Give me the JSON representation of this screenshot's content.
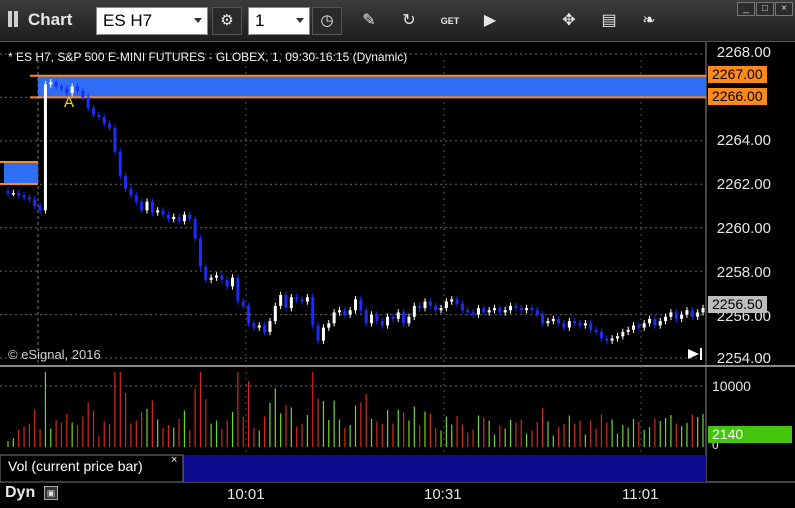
{
  "window": {
    "title": "Chart"
  },
  "toolbar": {
    "symbol": "ES H7",
    "interval": "1",
    "buttons": [
      {
        "name": "settings-icon",
        "glyph": "⚙"
      },
      {
        "name": "clock-icon",
        "glyph": "◷"
      },
      {
        "name": "pencil-icon",
        "glyph": "✎"
      },
      {
        "name": "refresh-icon",
        "glyph": "↻"
      },
      {
        "name": "get-icon",
        "glyph": "GET"
      },
      {
        "name": "play-icon",
        "glyph": "▶"
      },
      {
        "name": "pin-icon",
        "glyph": "✥"
      },
      {
        "name": "comment-icon",
        "glyph": "▤"
      },
      {
        "name": "twitter-icon",
        "glyph": "❧"
      }
    ],
    "window_buttons": [
      "_",
      "□",
      "×"
    ]
  },
  "chart": {
    "title": "* ES H7, S&P 500 E-MINI FUTURES - GLOBEX, 1, 09:30-16:15 (Dynamic)",
    "copyright": "© eSignal, 2016",
    "marker_label": "A",
    "price_ticks": [
      "2268.00",
      "2264.00",
      "2262.00",
      "2260.00",
      "2258.00",
      "2256.00",
      "2254.00"
    ],
    "price_tags": {
      "upper": "2267.00",
      "lower": "2266.00",
      "last": "2256.50"
    },
    "time_labels": [
      "10:01",
      "10:31",
      "11:01"
    ],
    "colors": {
      "band": "#2f6df5",
      "band_edge": "#ff8a1c",
      "up_candle": "#ffffff",
      "down_candle": "#1a2cff",
      "volume_up": "#6bd832",
      "volume_down": "#d42a1e",
      "volume_tag": "#44c40d"
    }
  },
  "volume": {
    "label": "Vol (current price bar)",
    "close_glyph": "×",
    "ticks": [
      "10000",
      "0"
    ],
    "current": "2140"
  },
  "footer": {
    "mode": "Dyn",
    "lock_glyph": "▣"
  },
  "chart_data": {
    "type": "candlestick",
    "title": "* ES H7, S&P 500 E-MINI FUTURES - GLOBEX, 1, 09:30-16:15 (Dynamic)",
    "ylim": [
      2254,
      2268
    ],
    "price_range_band": [
      2266,
      2267
    ],
    "last_price": 2256.5,
    "close": [
      2261.6,
      2261.6,
      2261.5,
      2261.4,
      2261.3,
      2261.0,
      2260.8,
      2266.6,
      2266.7,
      2266.5,
      2266.4,
      2266.2,
      2266.5,
      2266.3,
      2266.0,
      2265.5,
      2265.2,
      2265.1,
      2264.8,
      2264.6,
      2263.5,
      2262.4,
      2261.8,
      2261.5,
      2261.2,
      2260.8,
      2261.2,
      2260.7,
      2260.8,
      2260.6,
      2260.4,
      2260.5,
      2260.3,
      2260.6,
      2260.4,
      2259.5,
      2258.2,
      2257.6,
      2257.7,
      2257.8,
      2257.6,
      2257.3,
      2257.7,
      2256.6,
      2256.4,
      2255.6,
      2255.4,
      2255.5,
      2255.2,
      2255.7,
      2256.4,
      2256.9,
      2256.3,
      2256.8,
      2256.7,
      2256.6,
      2256.8,
      2255.5,
      2254.8,
      2255.4,
      2255.6,
      2256.1,
      2256.2,
      2256.0,
      2256.2,
      2256.7,
      2256.2,
      2255.6,
      2256.0,
      2255.7,
      2255.5,
      2255.9,
      2255.8,
      2256.1,
      2255.6,
      2255.9,
      2256.4,
      2256.3,
      2256.6,
      2256.4,
      2256.2,
      2256.3,
      2256.6,
      2256.7,
      2256.5,
      2256.2,
      2256.1,
      2256.0,
      2256.3,
      2256.1,
      2256.2,
      2256.3,
      2256.1,
      2256.2,
      2256.4,
      2256.3,
      2256.2,
      2256.3,
      2256.2,
      2256.0,
      2255.6,
      2255.7,
      2255.8,
      2255.6,
      2255.4,
      2255.7,
      2255.6,
      2255.5,
      2255.6,
      2255.3,
      2255.2,
      2254.9,
      2254.8,
      2254.9,
      2255.0,
      2255.2,
      2255.3,
      2255.5,
      2255.4,
      2255.6,
      2255.8,
      2255.5,
      2255.7,
      2255.9,
      2256.1,
      2255.8,
      2256.0,
      2256.2,
      2255.9,
      2256.1,
      2256.3
    ]
  }
}
